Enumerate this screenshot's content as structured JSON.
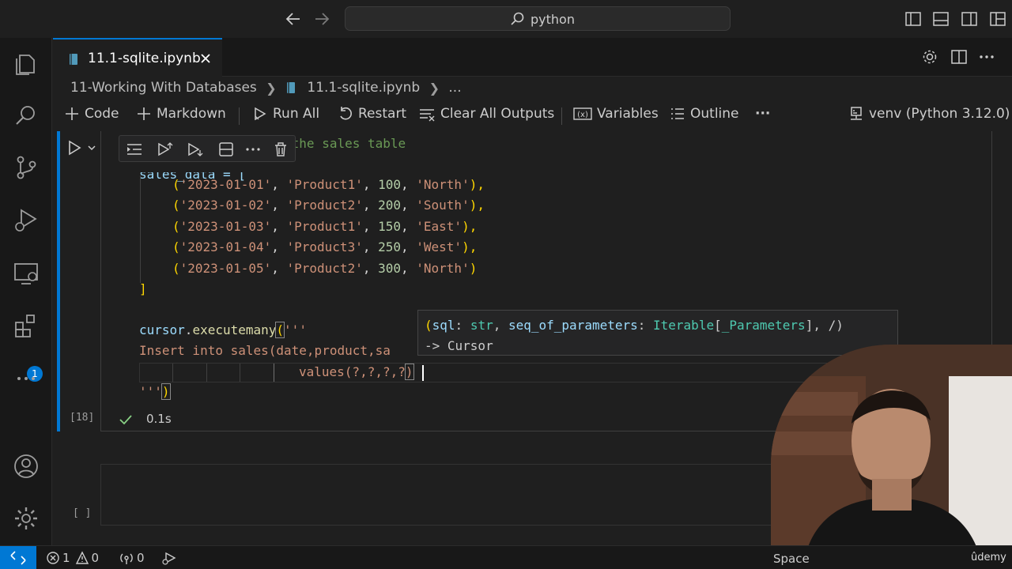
{
  "titlebar": {
    "search_text": "python"
  },
  "activity_bar": {
    "extensions_badge": "1"
  },
  "tab": {
    "label": "11.1-sqlite.ipynb"
  },
  "breadcrumb": {
    "folder": "11-Working With Databases",
    "file": "11.1-sqlite.ipynb",
    "more": "..."
  },
  "toolbar": {
    "code_label": "Code",
    "markdown_label": "Markdown",
    "run_all_label": "Run All",
    "restart_label": "Restart",
    "clear_outputs_label": "Clear All Outputs",
    "variables_label": "Variables",
    "outline_label": "Outline",
    "more_label": "···",
    "kernel_label": "venv (Python 3.12.0)"
  },
  "cell1": {
    "comment_visible": "the sales table",
    "var_line": "sales_data = [",
    "rows": [
      {
        "date": "'2023-01-01'",
        "product": "'Product1'",
        "qty": "100",
        "region": "'North'",
        "end": "),"
      },
      {
        "date": "'2023-01-02'",
        "product": "'Product2'",
        "qty": "200",
        "region": "'South'",
        "end": "),"
      },
      {
        "date": "'2023-01-03'",
        "product": "'Product1'",
        "qty": "150",
        "region": "'East'",
        "end": "),"
      },
      {
        "date": "'2023-01-04'",
        "product": "'Product3'",
        "qty": "250",
        "region": "'West'",
        "end": "),"
      },
      {
        "date": "'2023-01-05'",
        "product": "'Product2'",
        "qty": "300",
        "region": "'North'",
        "end": ")"
      }
    ],
    "close_bracket": "]",
    "exec_obj": "cursor",
    "exec_fn": "executemany",
    "exec_open": "(",
    "exec_str_open": "'''",
    "insert_line": "Insert into sales(date,product,sa",
    "values_line": "values(?,?,?,?",
    "values_close": ")",
    "str_close": "'''",
    "paren_close": ")",
    "exec_count": "[18]",
    "duration": "0.1s"
  },
  "signature_hint": {
    "param1": "sql",
    "type1": "str",
    "param2": "seq_of_parameters",
    "type2": "Iterable",
    "type2_inner": "_Parameters",
    "tail": "/)",
    "return_label": "-> Cursor"
  },
  "cell2": {
    "exec_count": "[ ]"
  },
  "statusbar": {
    "errors": "1",
    "warnings": "0",
    "ports": "0",
    "spaces": "Space"
  },
  "watermark": "ûdemy"
}
